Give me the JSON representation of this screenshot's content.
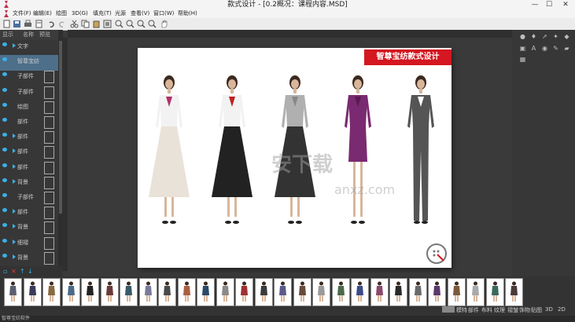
{
  "window": {
    "title": "款式设计 - [0.2概况：课程内容.MSD]",
    "min": "—",
    "max": "☐",
    "close": "✕"
  },
  "menu": [
    "文件(F)",
    "编辑(E)",
    "绘图",
    "3D(G)",
    "填充(T)",
    "光源",
    "查看(V)",
    "窗口(W)",
    "帮助(H)"
  ],
  "left_tabs": [
    "显示",
    "名称",
    "预览"
  ],
  "layers": [
    {
      "label": "文字",
      "has_arrow": true,
      "selected": false
    },
    {
      "label": "智尊宝纺",
      "has_arrow": false,
      "selected": true
    },
    {
      "label": "子部件",
      "has_arrow": false,
      "selected": false
    },
    {
      "label": "子部件",
      "has_arrow": false,
      "selected": false
    },
    {
      "label": "绘图",
      "has_arrow": false,
      "selected": false
    },
    {
      "label": "部件",
      "has_arrow": false,
      "selected": false
    },
    {
      "label": "部件",
      "has_arrow": true,
      "selected": false
    },
    {
      "label": "部件",
      "has_arrow": true,
      "selected": false
    },
    {
      "label": "部件",
      "has_arrow": true,
      "selected": false
    },
    {
      "label": "背景",
      "has_arrow": true,
      "selected": false
    },
    {
      "label": "子部件",
      "has_arrow": false,
      "selected": false
    },
    {
      "label": "部件",
      "has_arrow": true,
      "selected": false
    },
    {
      "label": "背景",
      "has_arrow": true,
      "selected": false
    },
    {
      "label": "细褶",
      "has_arrow": true,
      "selected": false
    },
    {
      "label": "背景",
      "has_arrow": true,
      "selected": false
    }
  ],
  "canvas": {
    "brand_text": "智尊宝纺款式设计",
    "watermark": "安下载",
    "watermark_url": "anxz.com"
  },
  "figures": [
    {
      "top": "#f2f2f2",
      "bottom": "#e9e2d8",
      "accent": "#b0306a"
    },
    {
      "top": "#f2f2f2",
      "bottom": "#222222",
      "accent": "#c02020"
    },
    {
      "top": "#b0b0b0",
      "bottom": "#333333",
      "accent": "#888888"
    },
    {
      "top": "#7a2a70",
      "bottom": "#7a2a70",
      "accent": "#5a1a50"
    },
    {
      "top": "#555555",
      "bottom": "#555555",
      "accent": "#ffffff"
    }
  ],
  "film_colors": [
    "#5a6070",
    "#3a3a5a",
    "#8a6a40",
    "#4a6a8a",
    "#222",
    "#6a3a3a",
    "#3a5a6a",
    "#7a7a9a",
    "#4a4a4a",
    "#aa6040",
    "#2a4a6a",
    "#8a8a8a",
    "#a03030",
    "#3a3a3a",
    "#5a5a8a",
    "#6a4a3a",
    "#9a9a9a",
    "#4a6a4a",
    "#3a4a8a",
    "#8a4a6a",
    "#2a2a2a",
    "#6a6a6a",
    "#5a3a6a",
    "#7a5a3a",
    "#aaaaaa",
    "#3a6a5a",
    "#4a3a3a"
  ],
  "bottom_tabs": [
    "模特",
    "部件",
    "布料",
    "纹理",
    "褶皱",
    "饰物",
    "贴图",
    "3D",
    "2D"
  ],
  "status": "智尊宝纺软件"
}
